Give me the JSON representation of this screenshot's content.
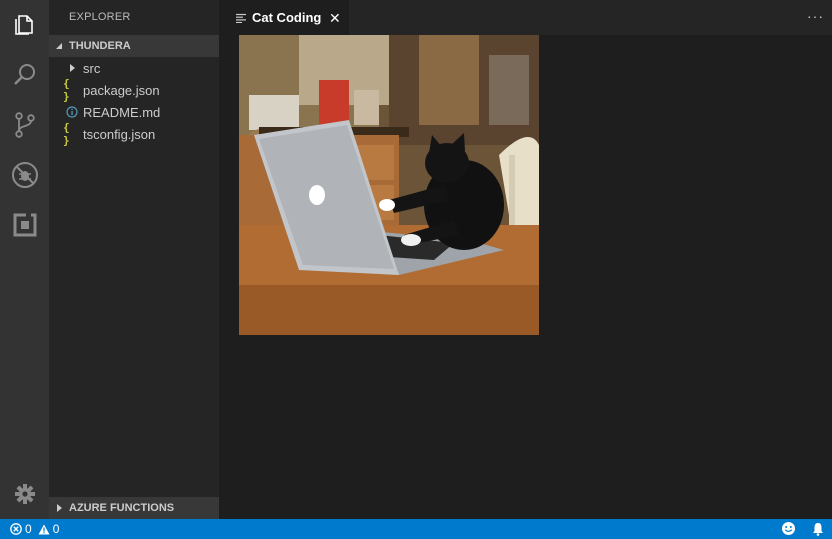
{
  "activity_bar": {
    "items": [
      {
        "name": "explorer-icon"
      },
      {
        "name": "search-icon"
      },
      {
        "name": "source-control-icon"
      },
      {
        "name": "debug-icon"
      },
      {
        "name": "extensions-icon"
      }
    ],
    "bottom": {
      "name": "gear-icon"
    }
  },
  "sidebar": {
    "title": "EXPLORER",
    "workspace": "THUNDERA",
    "items": [
      {
        "label": "src",
        "type": "folder"
      },
      {
        "label": "package.json",
        "type": "json"
      },
      {
        "label": "README.md",
        "type": "info"
      },
      {
        "label": "tsconfig.json",
        "type": "json"
      }
    ],
    "json_icon": "{ }",
    "azure_section": "AZURE FUNCTIONS"
  },
  "editor": {
    "tab_label": "Cat Coding",
    "close_glyph": "✕",
    "more_glyph": "···"
  },
  "statusbar": {
    "errors": "0",
    "warnings": "0"
  },
  "colors": {
    "accent": "#007acc",
    "activity_bar": "#333333",
    "sidebar": "#252526",
    "editor": "#1e1e1e"
  }
}
